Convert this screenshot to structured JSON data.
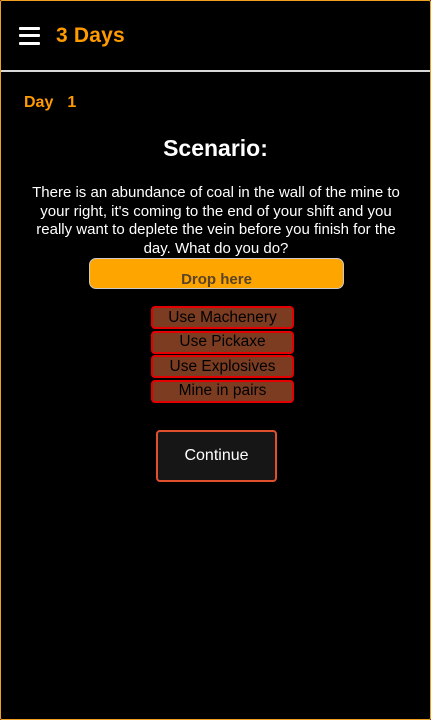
{
  "header": {
    "menu_icon": "hamburger-menu-icon",
    "title": "3 Days"
  },
  "day": {
    "label": "Day",
    "number": "1"
  },
  "scenario": {
    "heading": "Scenario:",
    "text": "There is an abundance of coal in the wall of the mine to your right, it's coming to the end of your shift and you really want to deplete the vein before you finish for the day. What do you do?"
  },
  "drop_zone": {
    "label": "Drop here"
  },
  "options": [
    {
      "label": "Use Machenery"
    },
    {
      "label": "Use Pickaxe"
    },
    {
      "label": "Use Explosives"
    },
    {
      "label": "Mine in pairs"
    }
  ],
  "continue": {
    "label": "Continue"
  },
  "colors": {
    "accent": "#ff9a00",
    "drop_zone": "#ffa500",
    "option_fill": "#7b3c22",
    "option_border": "#e40000",
    "continue_border": "#e0502c"
  }
}
